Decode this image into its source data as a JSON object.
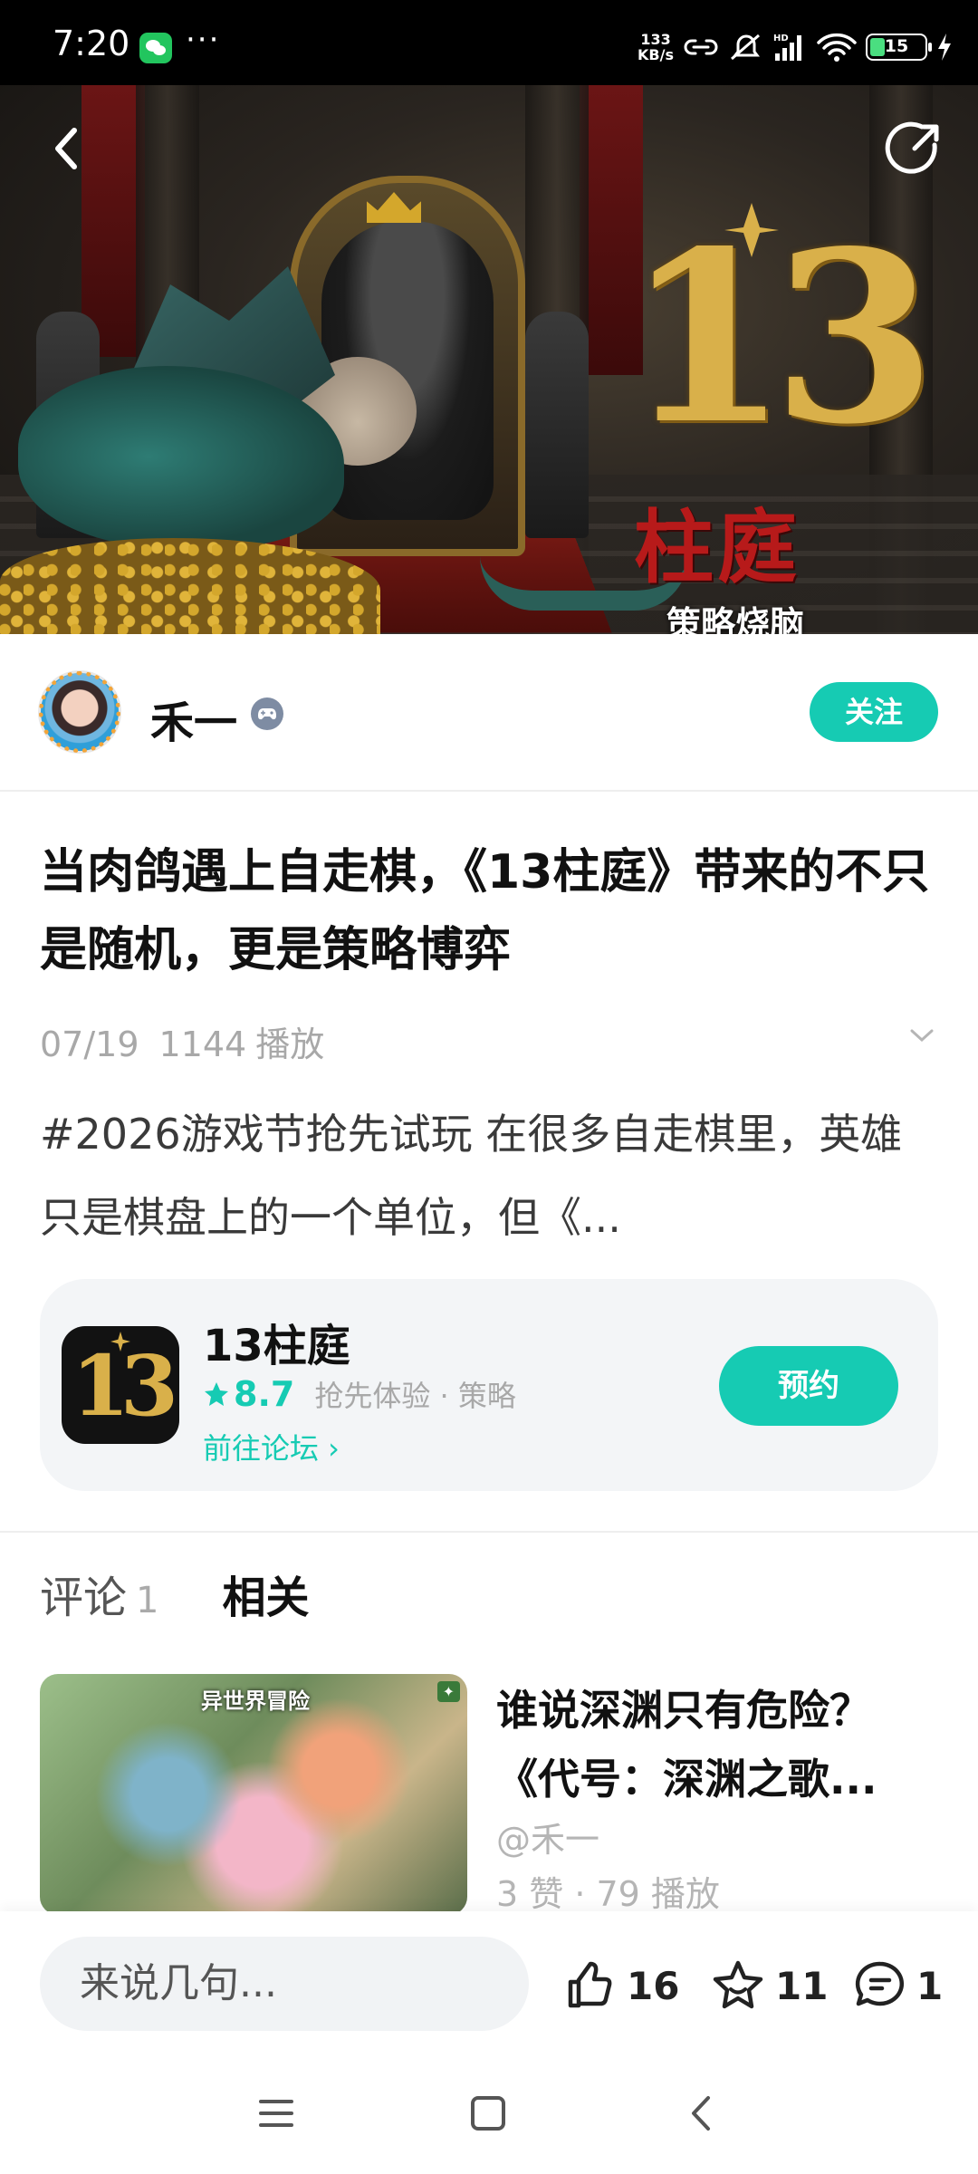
{
  "status_bar": {
    "time": "7:20",
    "net_speed_value": "133",
    "net_speed_unit": "KB/s",
    "battery": "15",
    "colors": {
      "background": "#000000",
      "battery_fill": "#4ade80",
      "wechat": "#22c55e"
    }
  },
  "hero": {
    "logo_number": "13",
    "logo_title": "柱庭",
    "logo_subtitle": "策略烧脑"
  },
  "author": {
    "name": "禾一",
    "follow_label": "关注"
  },
  "post": {
    "title": "当肉鸽遇上自走棋，《13柱庭》带来的不只是随机，更是策略博弈",
    "date": "07/19",
    "plays": "1144",
    "plays_label": "播放",
    "description": "#2026游戏节抢先试玩 在很多自走棋里，英雄只是棋盘上的一个单位，但《..."
  },
  "game_card": {
    "icon_text": "13",
    "name": "13柱庭",
    "rating": "8.7",
    "tags": "抢先体验 · 策略",
    "forum_link": "前往论坛 ›",
    "reserve_label": "预约"
  },
  "tabs": {
    "comments_label": "评论",
    "comments_count": "1",
    "related_label": "相关"
  },
  "related": {
    "thumb_label": "异世界冒险",
    "title_line1": "谁说深渊只有危险？",
    "title_line2": "《代号：深渊之歌...",
    "author": "@禾一",
    "stats": "3 赞 · 79 播放"
  },
  "bottom_bar": {
    "comment_placeholder": "来说几句...",
    "likes": "16",
    "favorites": "11",
    "comments": "1"
  },
  "theme": {
    "accent": "#16cbb3"
  }
}
